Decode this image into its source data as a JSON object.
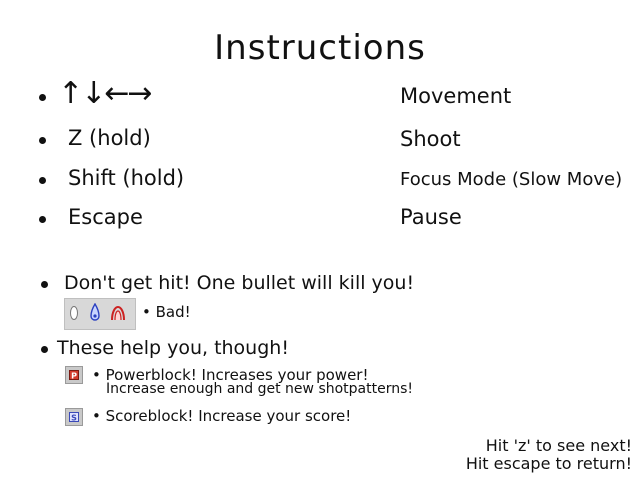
{
  "screen": {
    "title": "Instructions"
  },
  "controls": [
    {
      "key": "↑↓←→",
      "action": "Movement"
    },
    {
      "key": "Z (hold)",
      "action": "Shoot"
    },
    {
      "key": "Shift (hold)",
      "action": "Focus Mode (Slow Move)"
    },
    {
      "key": "Escape",
      "action": "Pause"
    }
  ],
  "warning": {
    "text": "Don't get hit! One bullet will kill you!",
    "bad_label": "• Bad!",
    "enemy_icons": [
      "white-oval-bullet-icon",
      "blue-drop-bullet-icon",
      "red-arc-bullet-icon"
    ]
  },
  "helpers": {
    "heading": "These help you, though!",
    "items": [
      {
        "icon": "powerblock-icon",
        "icon_letter": "P",
        "line1": "• Powerblock! Increases your power!",
        "line2": "Increase enough and get new shotpatterns!"
      },
      {
        "icon": "scoreblock-icon",
        "icon_letter": "S",
        "line1": "• Scoreblock! Increase your score!"
      }
    ]
  },
  "footer": {
    "next": "Hit 'z' to see next!",
    "back": "Hit escape to return!"
  },
  "colors": {
    "background": "#ffffff",
    "text": "#111111",
    "power_red": "#d33a2c",
    "score_blue": "#3a49b8",
    "panel_gray": "#d8d8d8"
  }
}
